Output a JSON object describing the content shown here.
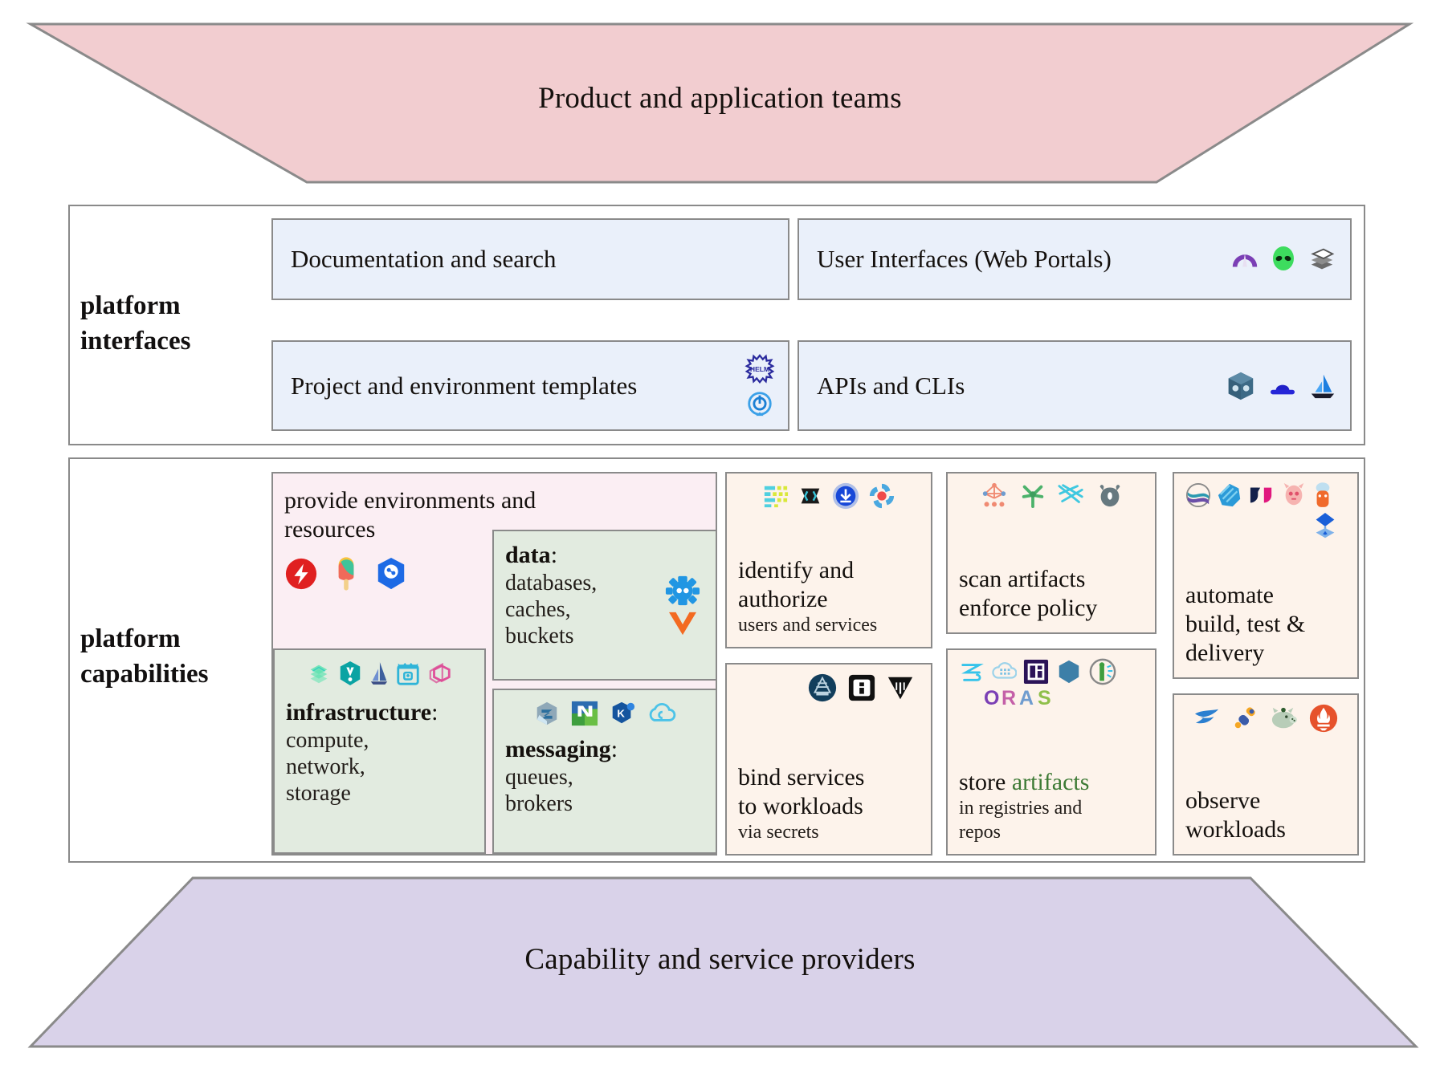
{
  "top_band": {
    "label": "Product and application teams",
    "fill": "#f2cdd0",
    "stroke": "#8a8a8a"
  },
  "bottom_band": {
    "label": "Capability and service providers",
    "fill": "#d9d2e9",
    "stroke": "#8a8a8a"
  },
  "interfaces": {
    "label": "platform\ninterfaces",
    "label_line1": "platform",
    "label_line2": "interfaces",
    "card_fill": "#eaf0fa",
    "cards": [
      {
        "id": "documentation-and-search",
        "title": "Documentation and search",
        "icons": []
      },
      {
        "id": "user-interfaces-web-portals",
        "title": "User Interfaces (Web Portals)",
        "icons": [
          "backstage-icon",
          "port-alien-icon",
          "kratix-stack-icon"
        ]
      },
      {
        "id": "project-and-environment-templates",
        "title": "Project and environment templates",
        "icons": [
          "helm-icon",
          "kustomize-icon"
        ]
      },
      {
        "id": "apis-and-clis",
        "title": "APIs and CLIs",
        "icons": [
          "crossplane-cube-icon",
          "bowler-hat-icon",
          "sailboat-icon"
        ]
      }
    ]
  },
  "capabilities": {
    "label_line1": "platform",
    "label_line2": "capabilities",
    "boxes": [
      {
        "id": "provide-environments-and-resources",
        "heading_line1": "provide environments and",
        "heading_line2": "resources",
        "fill": "#fbeef3",
        "icons": [
          "dapr-icon",
          "popsicle-icon",
          "kubevela-icon"
        ]
      },
      {
        "id": "data",
        "heading": "data",
        "heading_suffix": ":",
        "lines": [
          "databases,",
          "caches,",
          "buckets"
        ],
        "fill": "#e2ebe0",
        "icons": [
          "cloudnativepg-icon",
          "vitess-icon"
        ]
      },
      {
        "id": "infrastructure",
        "heading": "infrastructure",
        "heading_suffix": ":",
        "lines": [
          "compute,",
          "network,",
          "storage"
        ],
        "fill": "#e2ebe0",
        "icons": [
          "terraform-stack-icon",
          "pulumi-icon",
          "crossplane-sail-icon",
          "cluster-api-icon",
          "kubevirt-icon"
        ]
      },
      {
        "id": "messaging",
        "heading": "messaging",
        "heading_suffix": ":",
        "lines": [
          "queues,",
          "brokers"
        ],
        "fill": "#e2ebe0",
        "icons": [
          "knative-icon",
          "nats-icon",
          "kafka-strimzi-icon",
          "cloudevents-icon"
        ]
      },
      {
        "id": "identify-and-authorize",
        "heading_line1": "identify and",
        "heading_line2": "authorize",
        "sub": "users and services",
        "fill": "#fdf3eb",
        "icons": [
          "keycloak-list-icon",
          "spiffe-icon",
          "dex-icon",
          "openfga-icon"
        ]
      },
      {
        "id": "bind-services-to-workloads",
        "heading_line1": "bind services",
        "heading_line2": "to workloads",
        "sub": "via secrets",
        "fill": "#fdf3eb",
        "icons": [
          "external-secrets-icon",
          "secret-box-icon",
          "vault-icon"
        ]
      },
      {
        "id": "scan-artifacts-enforce-policy",
        "heading_line1": "scan artifacts",
        "heading_line2": "enforce policy",
        "fill": "#fdf3eb",
        "icons": [
          "kyverno-icon",
          "open-policy-agent-icon",
          "falco-icon",
          "gatekeeper-icon"
        ]
      },
      {
        "id": "store-artifacts",
        "heading_prefix": "store ",
        "heading_accent": "artifacts",
        "sub_line1": "in registries and",
        "sub_line2": "repos",
        "fill": "#fdf3eb",
        "icons": [
          "zot-icon",
          "harbor-cloud-icon",
          "oci-registry-icon",
          "hexagon-registry-icon",
          "notary-icon",
          "oras-wordmark-icon"
        ]
      },
      {
        "id": "automate-build-test-delivery",
        "heading_line1": "automate",
        "heading_line2": "build, test &",
        "heading_line3": "delivery",
        "accent_color": "#6d4fa8",
        "fill": "#fdf3eb",
        "icons": [
          "tekton-icon",
          "argo-icon",
          "flux-icon",
          "jenkins-x-icon",
          "keptn-icon",
          "shipwright-icon"
        ]
      },
      {
        "id": "observe-workloads",
        "heading_line1": "observe",
        "heading_line2": "workloads",
        "accent_color": "#7d2b4a",
        "fill": "#fdf3eb",
        "icons": [
          "fluentd-icon",
          "opentelemetry-icon",
          "thanos-pig-icon",
          "prometheus-icon"
        ]
      }
    ]
  }
}
